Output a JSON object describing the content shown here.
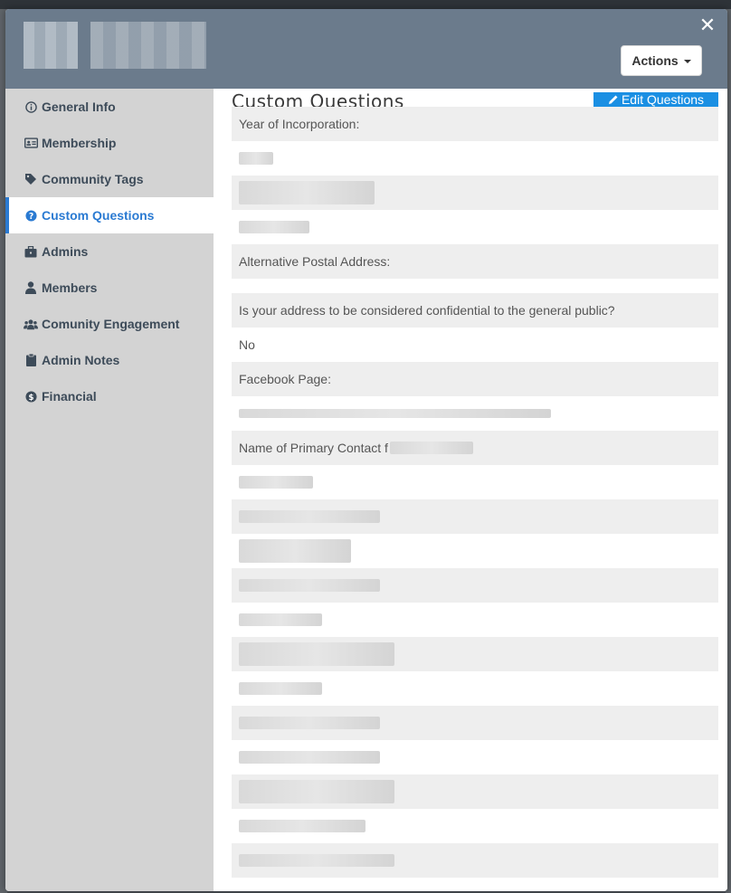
{
  "header": {
    "close_icon": "close-icon",
    "actions_label": "Actions"
  },
  "sidebar": {
    "items": [
      {
        "label": "General Info",
        "icon": "info-circle-icon",
        "active": false
      },
      {
        "label": "Membership",
        "icon": "id-card-icon",
        "active": false
      },
      {
        "label": "Community Tags",
        "icon": "tag-icon",
        "active": false
      },
      {
        "label": "Custom Questions",
        "icon": "question-circle-icon",
        "active": true
      },
      {
        "label": "Admins",
        "icon": "briefcase-icon",
        "active": false
      },
      {
        "label": "Members",
        "icon": "user-icon",
        "active": false
      },
      {
        "label": "Comunity Engagement",
        "icon": "users-icon",
        "active": false
      },
      {
        "label": "Admin Notes",
        "icon": "clipboard-icon",
        "active": false
      },
      {
        "label": "Financial",
        "icon": "dollar-circle-icon",
        "active": false
      }
    ]
  },
  "main": {
    "title": "Custom Questions",
    "edit_label": "Edit Questions",
    "questions": [
      {
        "q": "Year of Incorporation:",
        "a": ""
      },
      {
        "q": "",
        "a": ""
      },
      {
        "q": "Alternative Postal Address:",
        "a": ""
      },
      {
        "q": "Is your address to be considered confidential to the general public?",
        "a": "No"
      },
      {
        "q": "Facebook Page:",
        "a": ""
      },
      {
        "q": "Name of Primary Contact f",
        "a": ""
      }
    ]
  },
  "colors": {
    "header_bg": "#6b7b8c",
    "sidebar_bg": "#d3d3d3",
    "accent": "#2a7ad2",
    "edit_button": "#1a8fe3",
    "question_row": "#eeeeee"
  }
}
